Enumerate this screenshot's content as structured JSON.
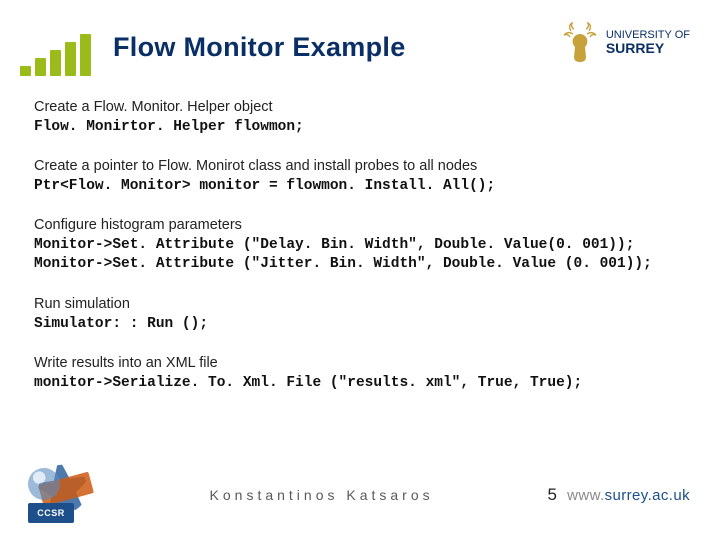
{
  "title": "Flow Monitor Example",
  "surrey": {
    "line1": "UNIVERSITY OF",
    "line2": "SURREY"
  },
  "blocks": {
    "b1": {
      "label": "Create a Flow. Monitor. Helper object",
      "code": "Flow. Monirtor. Helper flowmon;"
    },
    "b2": {
      "label": "Create a pointer to Flow. Monirot class and install probes to all nodes",
      "code": "Ptr<Flow. Monitor> monitor = flowmon. Install. All();"
    },
    "b3": {
      "label": "Configure histogram parameters",
      "code1": "Monitor->Set. Attribute (\"Delay. Bin. Width\", Double. Value(0. 001));",
      "code2": "Monitor->Set. Attribute (\"Jitter. Bin. Width\", Double. Value (0. 001));"
    },
    "b4": {
      "label": "Run simulation",
      "code": "Simulator: : Run ();"
    },
    "b5": {
      "label": "Write results into an XML file",
      "code": "monitor->Serialize. To. Xml. File (\"results. xml\", True, True);"
    }
  },
  "footer": {
    "badge": "CCSR",
    "author": "Konstantinos Katsaros",
    "page": "5",
    "url_prefix": "www.",
    "url_host": "surrey.ac.uk"
  }
}
